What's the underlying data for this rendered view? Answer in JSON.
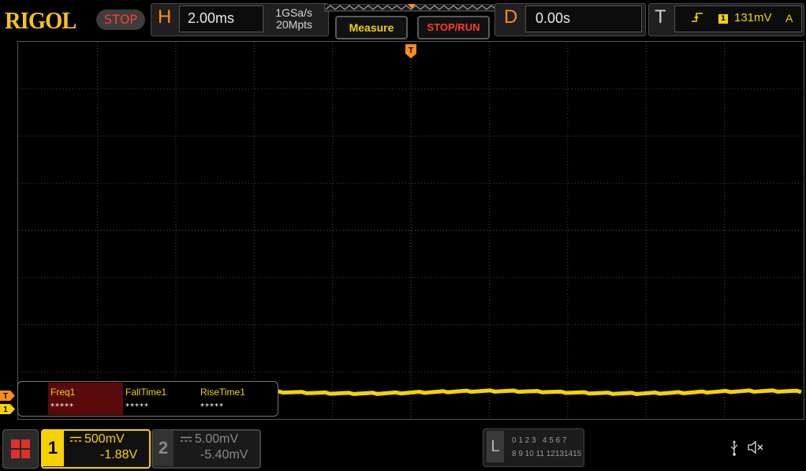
{
  "header": {
    "brand": "RIGOL",
    "run_state": "STOP",
    "horizontal": {
      "letter": "H",
      "timebase": "2.00ms",
      "sample_rate": "1GSa/s",
      "memory_depth": "20Mpts"
    },
    "measure_label": "Measure",
    "stoprun_label": "STOP/RUN",
    "delay": {
      "letter": "D",
      "value": "0.00s"
    },
    "trigger": {
      "letter": "T",
      "source": "1",
      "level": "131mV",
      "mode": "A"
    }
  },
  "markers": {
    "trigger_top": "T",
    "left_trigger": "T",
    "left_channel": "1"
  },
  "measurements": [
    {
      "name": "Freq1",
      "value": "*****"
    },
    {
      "name": "FallTime1",
      "value": "*****"
    },
    {
      "name": "RiseTime1",
      "value": "*****"
    }
  ],
  "channels": {
    "ch1": {
      "number": "1",
      "scale": "500mV",
      "offset": "-1.88V",
      "color": "#f5d300"
    },
    "ch2": {
      "number": "2",
      "scale": "5.00mV",
      "offset": "-5.40mV",
      "color": "#8a8a8a"
    }
  },
  "logic": {
    "letter": "L",
    "row1": "0 1 2 3   4 5 6 7",
    "row2": "8 9 10 11 12131415"
  },
  "icons": [
    "home-grid-icon",
    "usb-icon",
    "speaker-muted-icon"
  ],
  "colors": {
    "brand": "#f5c518",
    "stop": "#ff3b30",
    "accent": "#ff8c1a",
    "trace": "#f5d300"
  }
}
